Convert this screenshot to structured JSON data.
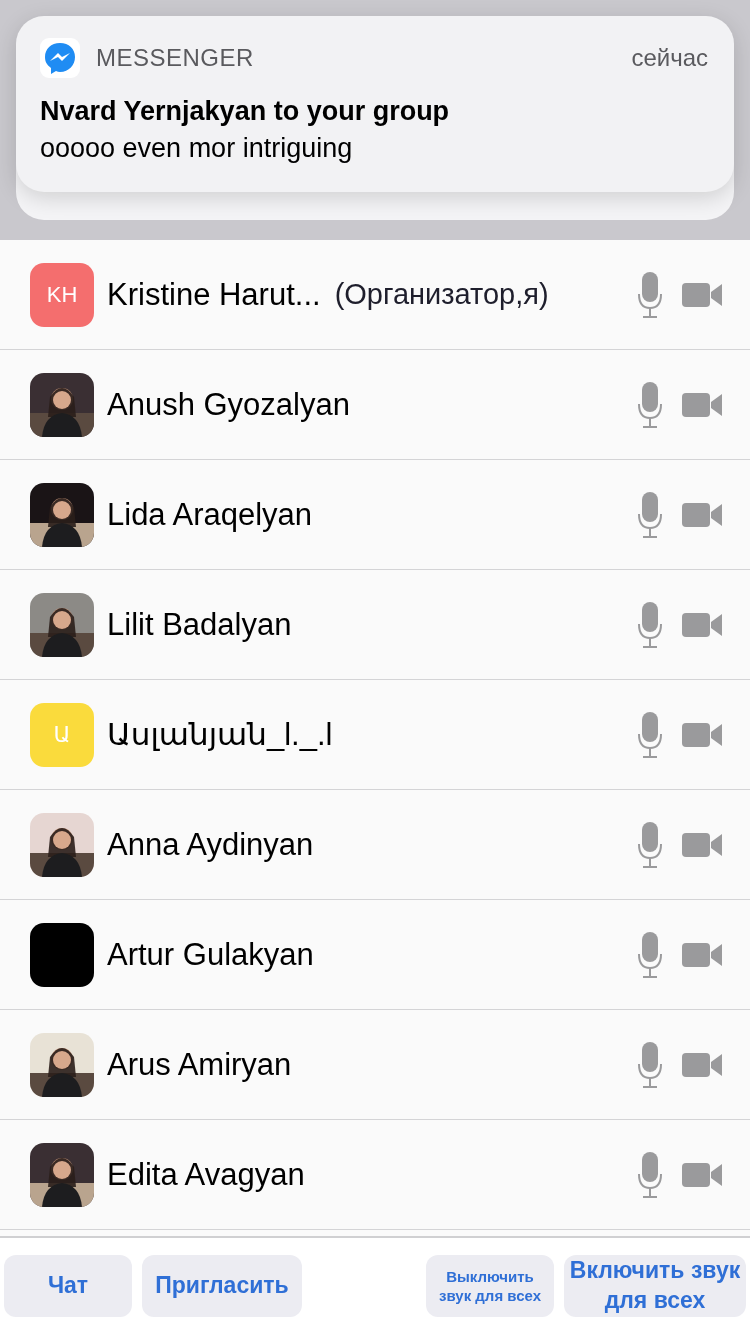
{
  "notification": {
    "app": "MESSENGER",
    "time": "сейчас",
    "title": "Nvard Yernjakyan to your group",
    "message": "ooooo even mor intriguing"
  },
  "participants": [
    {
      "avatar": {
        "kind": "initials",
        "initials": "KH",
        "color": "#f46e6e"
      },
      "name": "Kristine Harut...",
      "role": "(Организатор,я)"
    },
    {
      "name": "Anush Gyozalyan"
    },
    {
      "name": "Lida Araqelyan"
    },
    {
      "name": "Lilit Badalyan"
    },
    {
      "avatar": {
        "kind": "initials",
        "initials": "Ա",
        "color": "#fadb3c"
      },
      "name": "Ասլանյան_l._.l"
    },
    {
      "name": "Anna Aydinyan"
    },
    {
      "avatar": {
        "kind": "blank"
      },
      "name": "Artur Gulakyan"
    },
    {
      "name": "Arus Amiryan"
    },
    {
      "name": "Edita Avagyan"
    }
  ],
  "buttons": [
    {
      "label": "Чат",
      "kind": "large"
    },
    {
      "label": "Пригласить",
      "kind": "large"
    },
    {
      "label": "Выключить звук для всех",
      "kind": "small"
    },
    {
      "label": "Включить звук для всех",
      "kind": "large"
    }
  ]
}
